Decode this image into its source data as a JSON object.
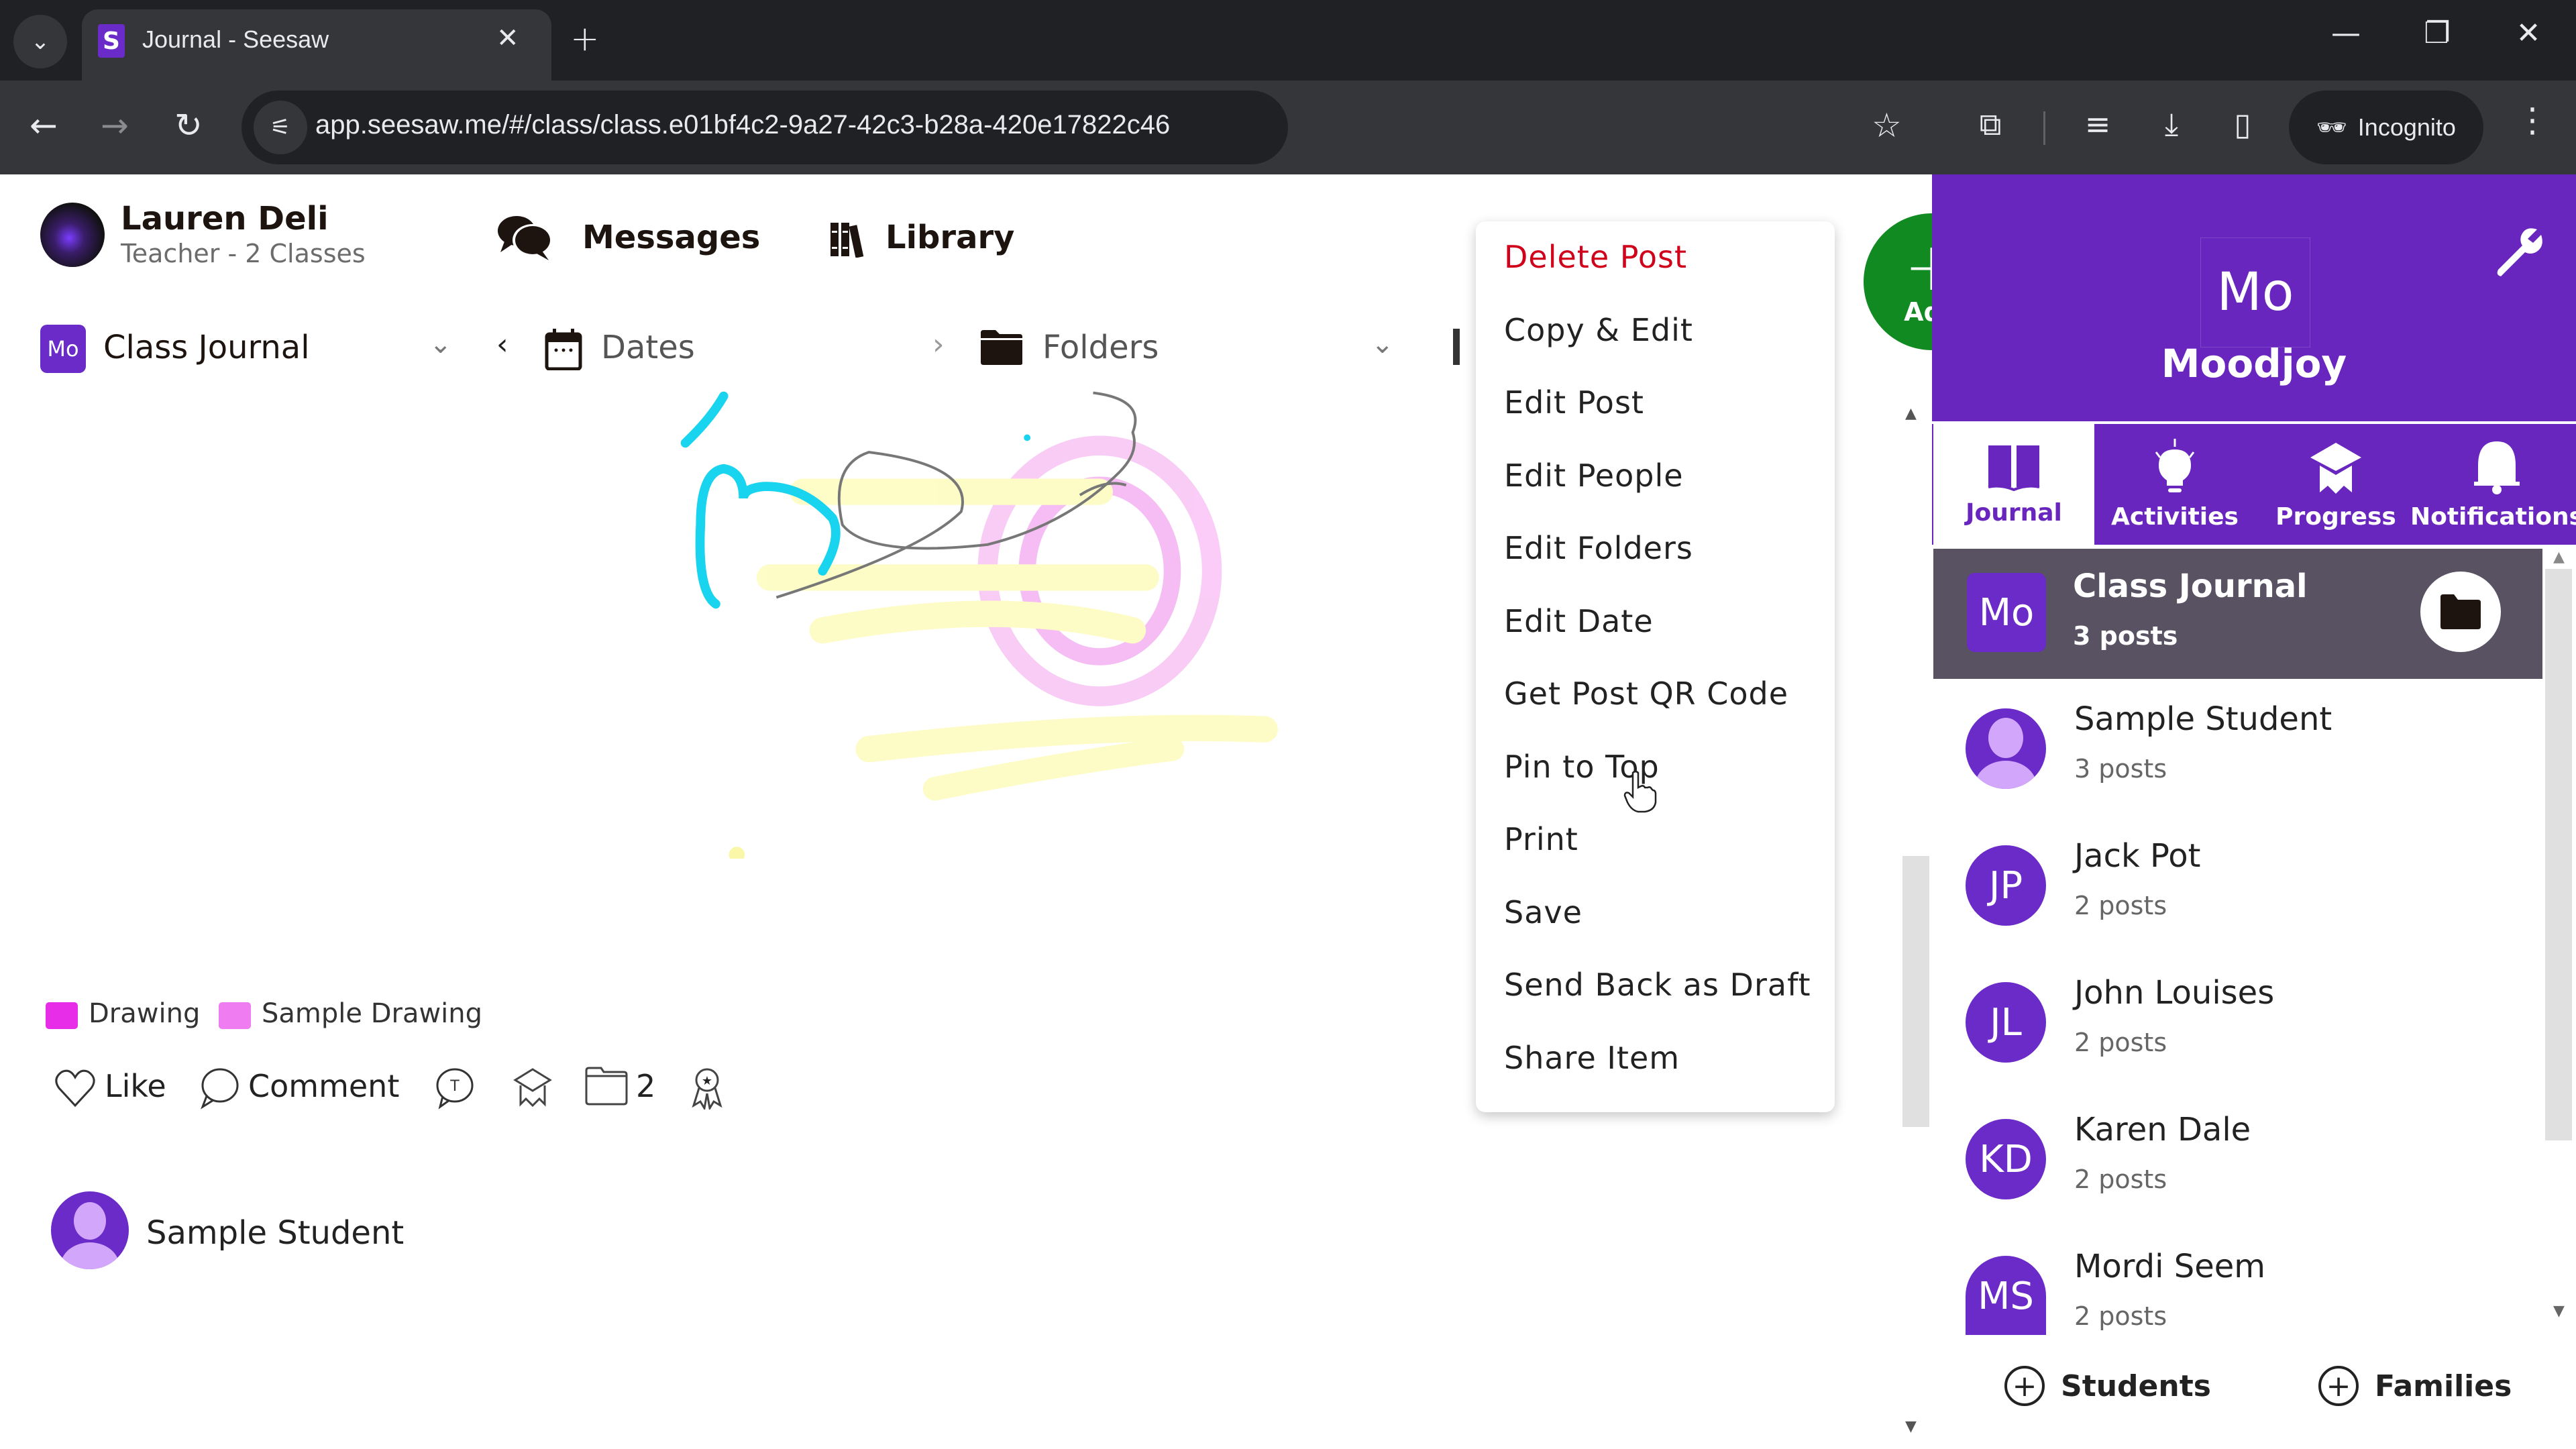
{
  "browser": {
    "tab_title": "Journal - Seesaw",
    "favicon": "S",
    "url": "app.seesaw.me/#/class/class.e01bf4c2-9a27-42c3-b28a-420e17822c46",
    "incognito_label": "Incognito",
    "icons": {
      "tab_list": "chevron-down-icon",
      "close_tab": "close-icon",
      "new_tab": "plus-icon",
      "back": "arrow-left-icon",
      "forward": "arrow-right-icon",
      "reload": "reload-icon",
      "site_info": "tune-icon",
      "bookmark": "star-icon",
      "extensions": "puzzle-icon",
      "media": "media-control-icon",
      "download": "download-icon",
      "side_panel": "side-panel-icon",
      "incognito": "incognito-icon",
      "menu": "kebab-menu-icon",
      "minimize": "minimize-icon",
      "restore": "restore-icon",
      "close_window": "close-icon"
    },
    "glyphs": {
      "tab_list": "⌄",
      "close_tab": "✕",
      "new_tab": "+",
      "back": "←",
      "forward": "→",
      "reload": "↻",
      "site_info": "⚟",
      "bookmark": "☆",
      "extensions": "⧉",
      "media": "≡",
      "download": "⤓",
      "side_panel": "▯",
      "incognito": "🕶",
      "menu": "⋮",
      "minimize": "—",
      "restore": "❐",
      "close_window": "✕"
    }
  },
  "header": {
    "teacher_name": "Lauren Deli",
    "teacher_subtitle": "Teacher - 2 Classes",
    "messages_label": "Messages",
    "library_label": "Library"
  },
  "filters": {
    "class_chip": "Mo",
    "class_label": "Class Journal",
    "dates_label": "Dates",
    "folders_label": "Folders",
    "chevron_down": "⌄",
    "prev": "‹",
    "next": "›"
  },
  "post": {
    "folders": [
      {
        "label": "Drawing",
        "color": "#e82de8"
      },
      {
        "label": "Sample Drawing",
        "color": "#ef7cf0"
      }
    ],
    "actions": {
      "like_label": "Like",
      "comment_label": "Comment",
      "folder_count": "2"
    },
    "author": "Sample Student"
  },
  "context_menu": {
    "items": [
      {
        "label": "Delete Post",
        "danger": true
      },
      {
        "label": "Copy & Edit"
      },
      {
        "label": "Edit Post"
      },
      {
        "label": "Edit People"
      },
      {
        "label": "Edit Folders"
      },
      {
        "label": "Edit Date"
      },
      {
        "label": "Get Post QR Code"
      },
      {
        "label": "Pin to Top",
        "hovered": true
      },
      {
        "label": "Print"
      },
      {
        "label": "Save"
      },
      {
        "label": "Send Back as Draft"
      },
      {
        "label": "Share Item"
      }
    ]
  },
  "add_button": {
    "plus": "+",
    "label": "Add"
  },
  "class_panel": {
    "logo": "Mo",
    "name": "Moodjoy",
    "accent_color": "#6826bf",
    "tabs": [
      {
        "label": "Journal",
        "active": true
      },
      {
        "label": "Activities"
      },
      {
        "label": "Progress"
      },
      {
        "label": "Notifications"
      }
    ],
    "class_journal": {
      "chip": "Mo",
      "title": "Class Journal",
      "count": "3 posts"
    },
    "students": [
      {
        "initials": "",
        "name": "Sample Student",
        "count": "3 posts",
        "generic_avatar": true
      },
      {
        "initials": "JP",
        "name": "Jack Pot",
        "count": "2 posts"
      },
      {
        "initials": "JL",
        "name": "John Louises",
        "count": "2 posts"
      },
      {
        "initials": "KD",
        "name": "Karen Dale",
        "count": "2 posts"
      },
      {
        "initials": "MS",
        "name": "Mordi Seem",
        "count": "2 posts"
      }
    ],
    "add_students_label": "Students",
    "add_families_label": "Families",
    "plus": "+"
  }
}
